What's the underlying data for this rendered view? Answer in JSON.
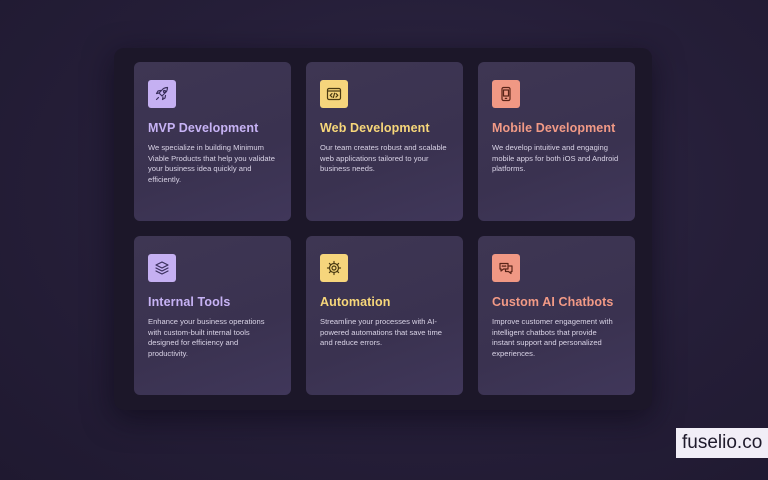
{
  "cards": [
    {
      "title": "MVP Development",
      "description": "We specialize in building Minimum Viable Products that help you validate your business idea quickly and efficiently.",
      "icon": "rocket-icon",
      "accent": "#c7b3f5",
      "icon_bg": "#c5b0f2"
    },
    {
      "title": "Web Development",
      "description": "Our team creates robust and scalable web applications tailored to your business needs.",
      "icon": "code-window-icon",
      "accent": "#f7d77a",
      "icon_bg": "#f6d57c"
    },
    {
      "title": "Mobile Development",
      "description": "We develop intuitive and engaging mobile apps for both iOS and Android platforms.",
      "icon": "smartphone-icon",
      "accent": "#f29a86",
      "icon_bg": "#f09884"
    },
    {
      "title": "Internal Tools",
      "description": "Enhance your business operations with custom-built internal tools designed for efficiency and productivity.",
      "icon": "layers-icon",
      "accent": "#c7b3f5",
      "icon_bg": "#c5b0f2"
    },
    {
      "title": "Automation",
      "description": "Streamline your processes with AI-powered automations that save time and reduce errors.",
      "icon": "gear-icon",
      "accent": "#f7d77a",
      "icon_bg": "#f6d57c"
    },
    {
      "title": "Custom AI Chatbots",
      "description": "Improve customer engagement with intelligent chatbots that provide instant support and personalized experiences.",
      "icon": "chat-bubble-icon",
      "accent": "#f29a86",
      "icon_bg": "#f09884"
    }
  ],
  "watermark": "fuselio.co"
}
